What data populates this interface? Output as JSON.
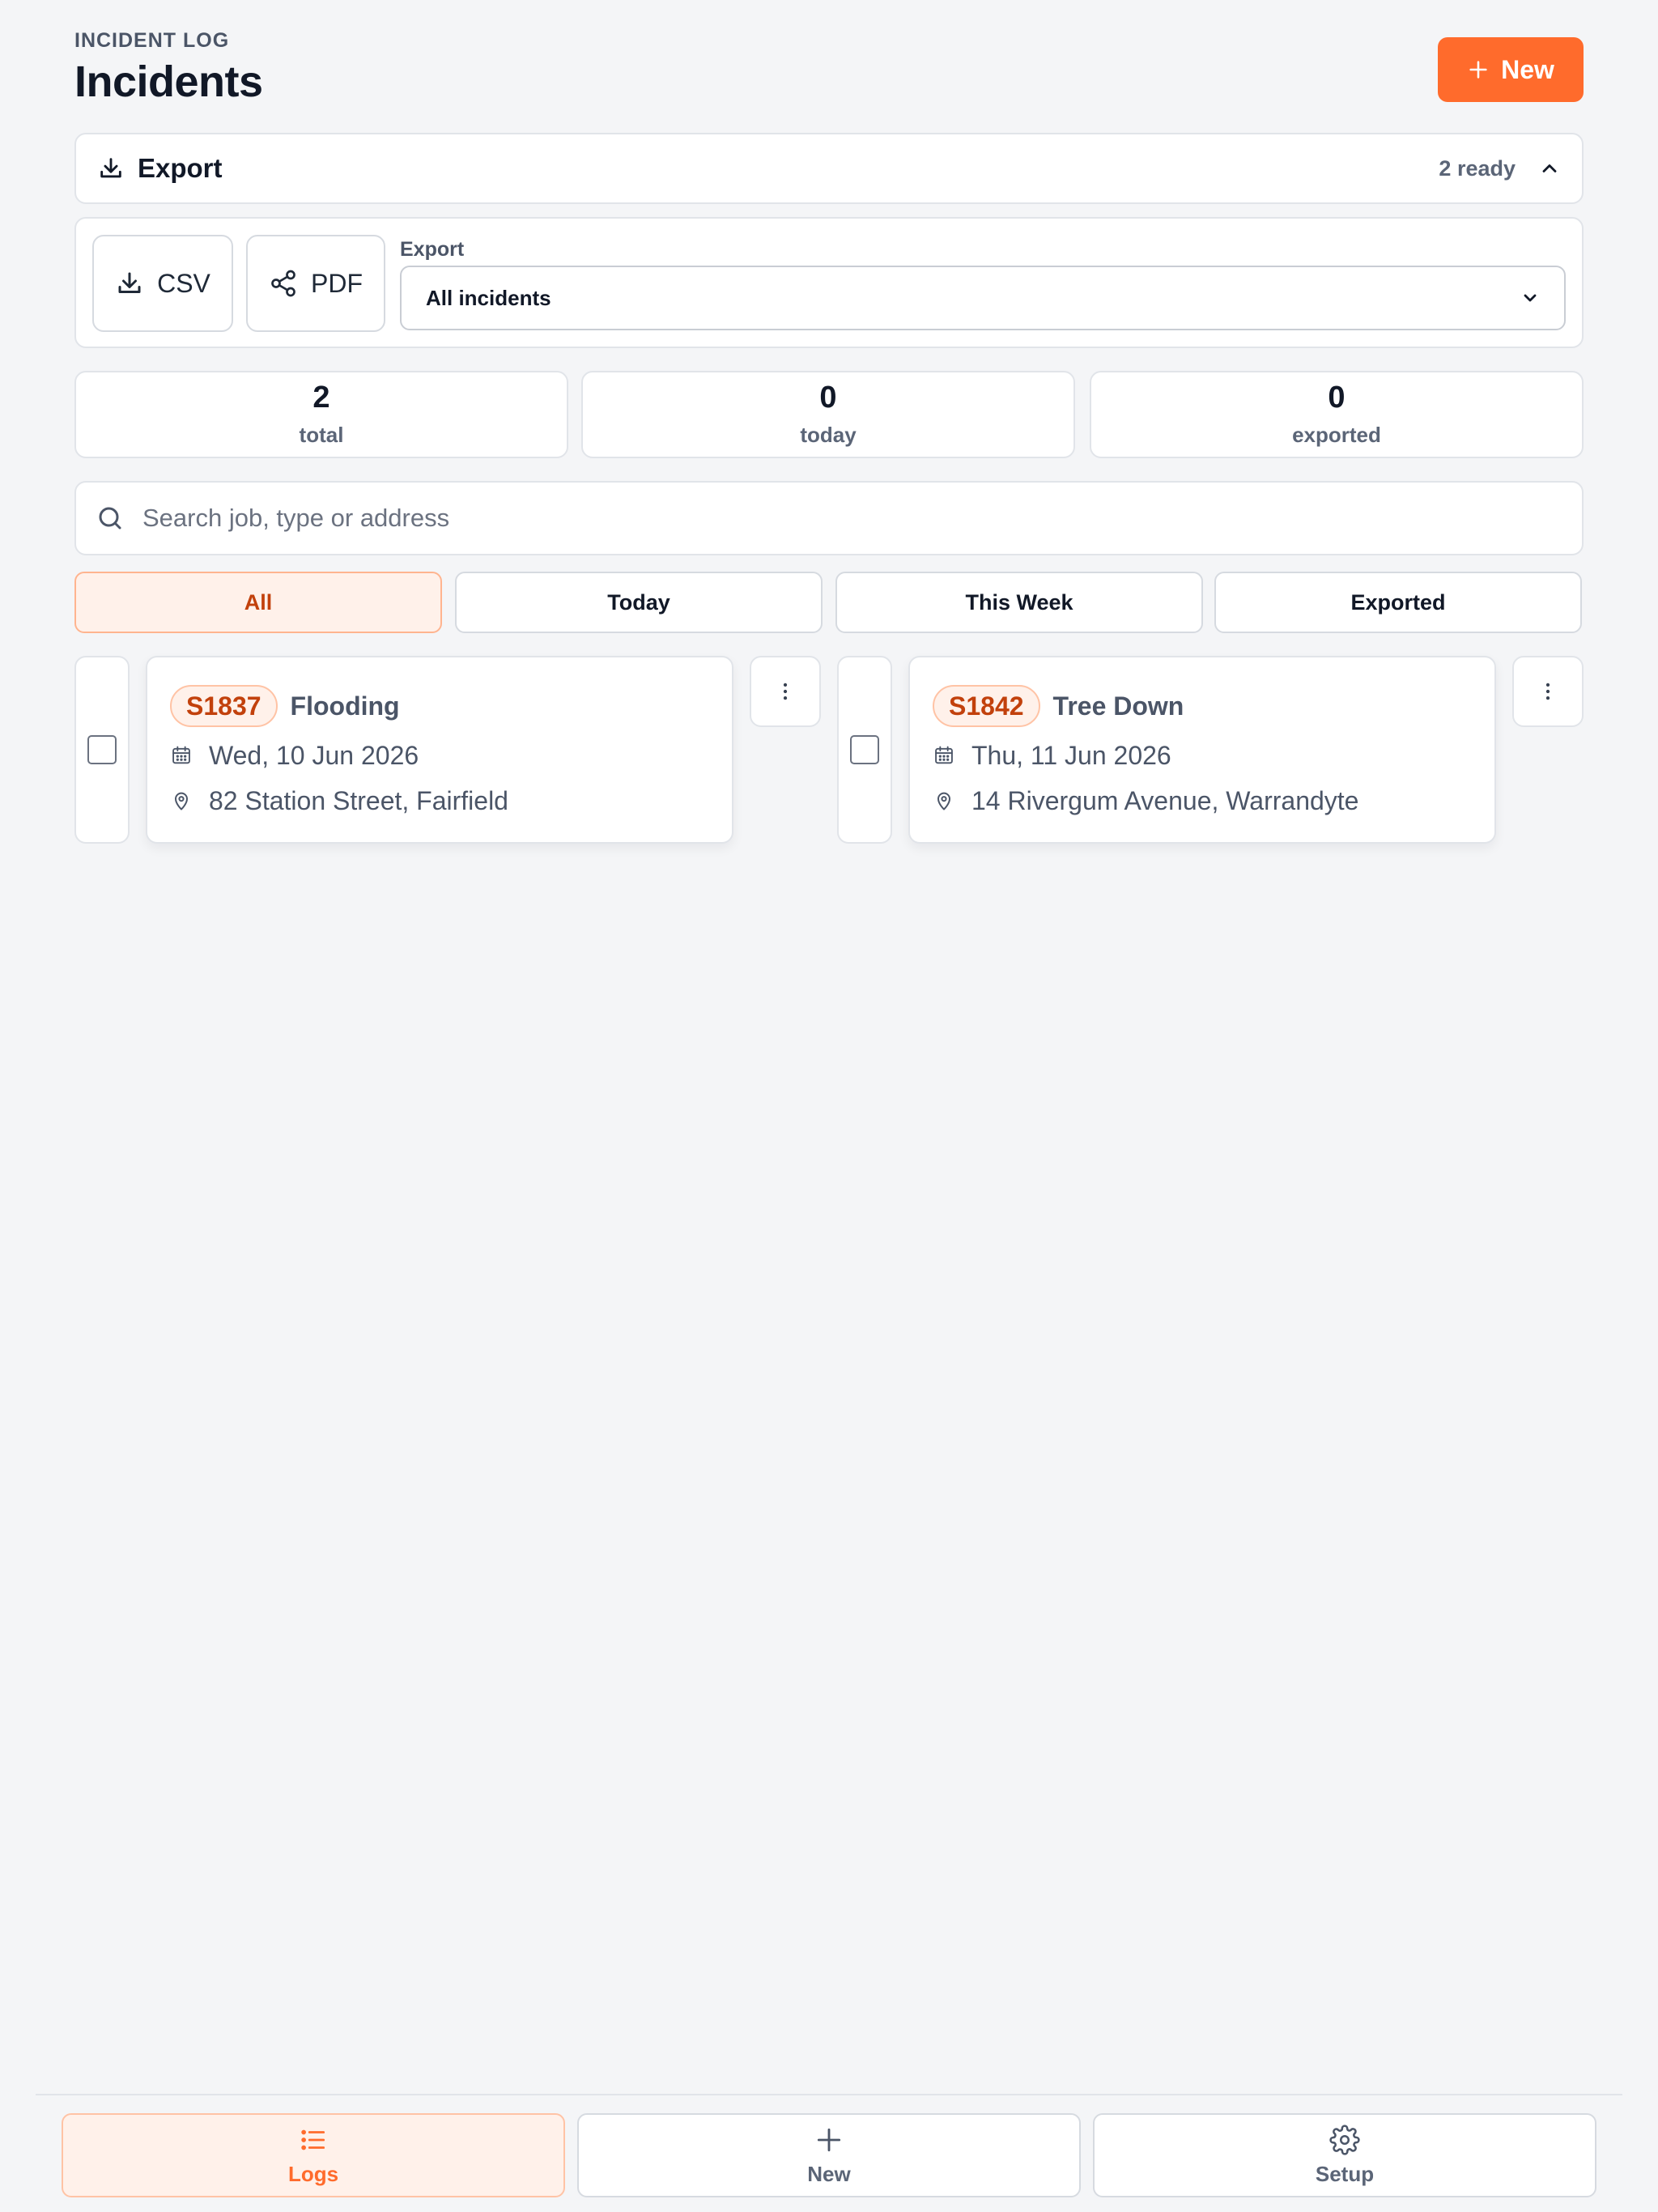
{
  "header": {
    "eyebrow": "INCIDENT LOG",
    "title": "Incidents",
    "new_label": "New"
  },
  "export_bar": {
    "label": "Export",
    "status": "2 ready"
  },
  "export_panel": {
    "csv_label": "CSV",
    "pdf_label": "PDF",
    "select_label": "Export",
    "select_value": "All incidents"
  },
  "stats": [
    {
      "value": "2",
      "label": "total"
    },
    {
      "value": "0",
      "label": "today"
    },
    {
      "value": "0",
      "label": "exported"
    }
  ],
  "search": {
    "placeholder": "Search job, type or address"
  },
  "filters": [
    {
      "label": "All",
      "active": true
    },
    {
      "label": "Today",
      "active": false
    },
    {
      "label": "This Week",
      "active": false
    },
    {
      "label": "Exported",
      "active": false
    }
  ],
  "incidents": [
    {
      "job": "S1837",
      "type": "Flooding",
      "date": "Wed, 10 Jun 2026",
      "address": "82 Station Street, Fairfield",
      "selected": false
    },
    {
      "job": "S1842",
      "type": "Tree Down",
      "date": "Thu, 11 Jun 2026",
      "address": "14 Rivergum Avenue, Warrandyte",
      "selected": false
    }
  ],
  "bottom_nav": [
    {
      "label": "Logs",
      "icon": "list-icon",
      "active": true
    },
    {
      "label": "New",
      "icon": "plus-icon",
      "active": false
    },
    {
      "label": "Setup",
      "icon": "gear-icon",
      "active": false
    }
  ],
  "colors": {
    "accent": "#ff6b2c",
    "accent_dark": "#c2410c",
    "accent_soft": "#fff1ea",
    "background": "#f4f5f7"
  }
}
